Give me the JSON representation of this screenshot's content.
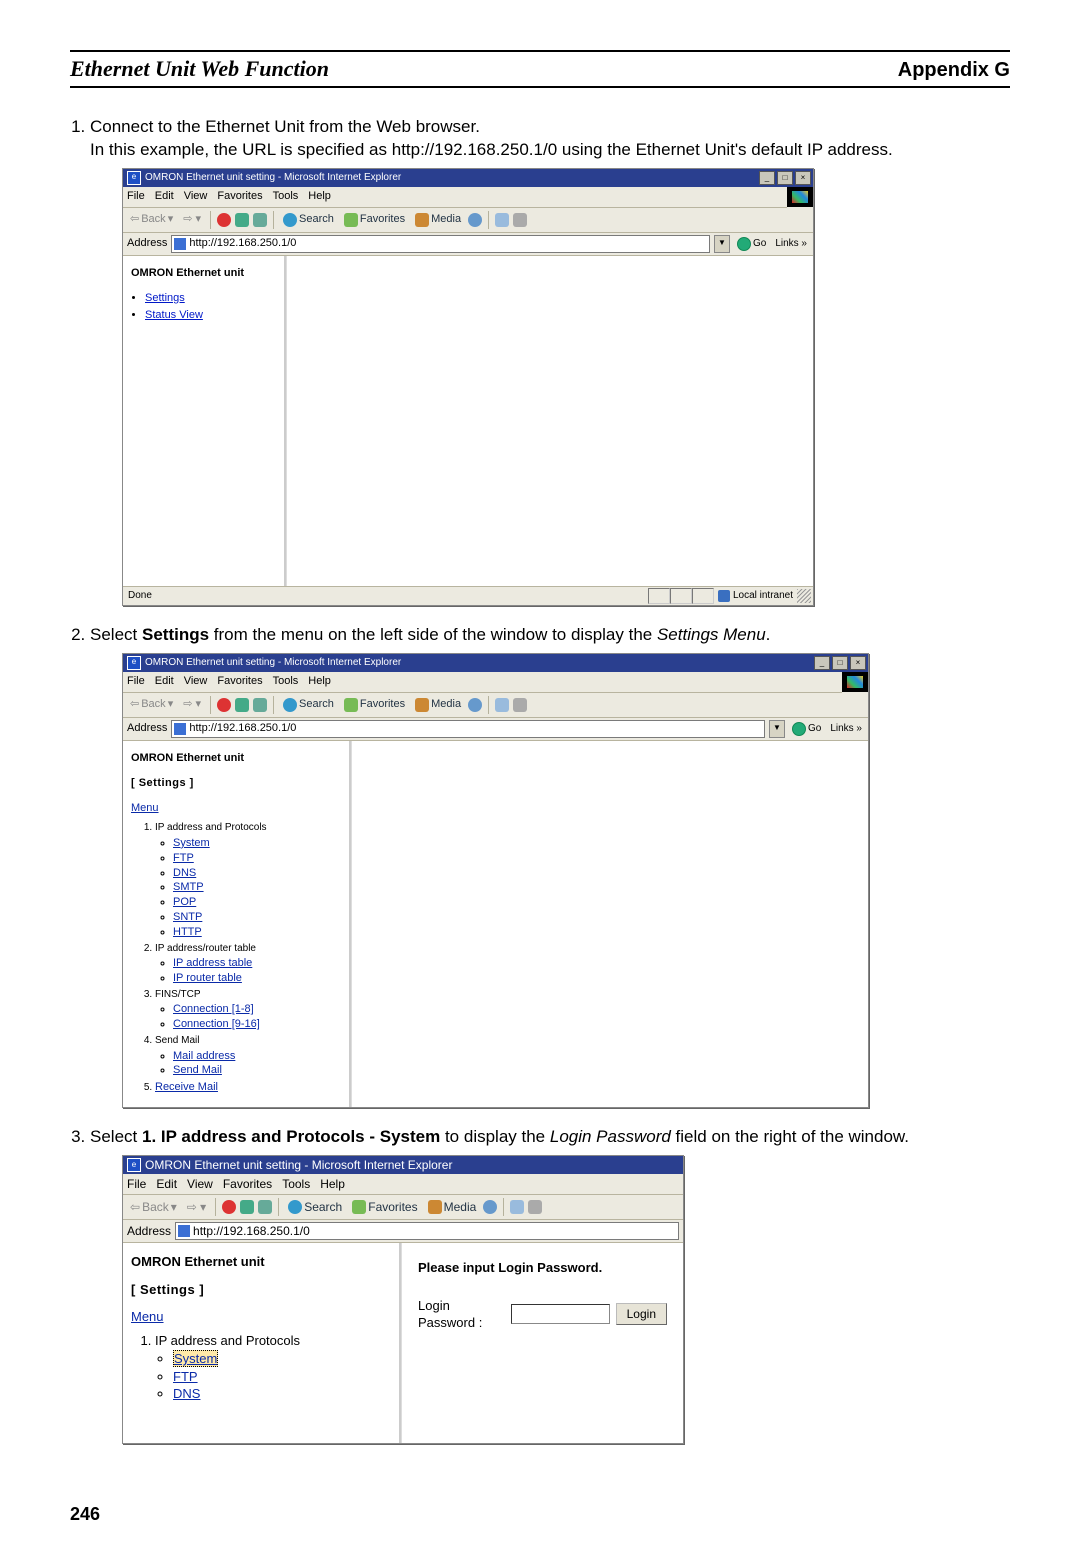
{
  "header": {
    "section_title": "Ethernet Unit Web Function",
    "appendix": "Appendix G"
  },
  "steps": {
    "s1_a": "Connect to the Ethernet Unit from the Web browser.",
    "s1_b": "In this example, the URL is specified as http://192.168.250.1/0 using the Ethernet Unit's default IP address.",
    "s2_pre": "Select ",
    "s2_bold": "Settings",
    "s2_mid": " from the menu on the left side of the window to display the ",
    "s2_ital": "Settings Menu",
    "s2_end": ".",
    "s3_pre": "Select ",
    "s3_bold": "1. IP address and Protocols - System",
    "s3_mid": " to display the ",
    "s3_ital": "Login Password",
    "s3_end": " field on the right of the window."
  },
  "browser": {
    "title": "OMRON Ethernet unit setting - Microsoft Internet Explorer",
    "menus": [
      "File",
      "Edit",
      "View",
      "Favorites",
      "Tools",
      "Help"
    ],
    "toolbar": {
      "back": "Back",
      "search": "Search",
      "favorites": "Favorites",
      "media": "Media"
    },
    "address_label": "Address",
    "url": "http://192.168.250.1/0",
    "go": "Go",
    "links": "Links »",
    "status_done": "Done",
    "status_zone": "Local intranet"
  },
  "sidebar1": {
    "title": "OMRON Ethernet unit",
    "links": [
      "Settings",
      "Status View"
    ]
  },
  "sidebar2": {
    "title": "OMRON Ethernet unit",
    "heading": "[ Settings ]",
    "menu_label": "Menu",
    "items": [
      {
        "label": "IP address and Protocols",
        "children": [
          "System",
          "FTP",
          "DNS",
          "SMTP",
          "POP",
          "SNTP",
          "HTTP"
        ]
      },
      {
        "label": "IP address/router table",
        "children": [
          "IP address table",
          "IP router table"
        ]
      },
      {
        "label": "FINS/TCP",
        "children": [
          "Connection [1-8]",
          "Connection [9-16]"
        ]
      },
      {
        "label": "Send Mail",
        "children": [
          "Mail address",
          "Send Mail"
        ]
      },
      {
        "label": "Receive Mail",
        "children": []
      }
    ]
  },
  "sidebar3": {
    "title": "OMRON Ethernet unit",
    "heading": "[ Settings ]",
    "menu_label": "Menu",
    "items": [
      {
        "label": "IP address and Protocols",
        "children": [
          "System",
          "FTP",
          "DNS"
        ]
      }
    ]
  },
  "login_pane": {
    "heading": "Please input Login Password.",
    "label": "Login Password :",
    "button": "Login"
  },
  "page_number": "246"
}
